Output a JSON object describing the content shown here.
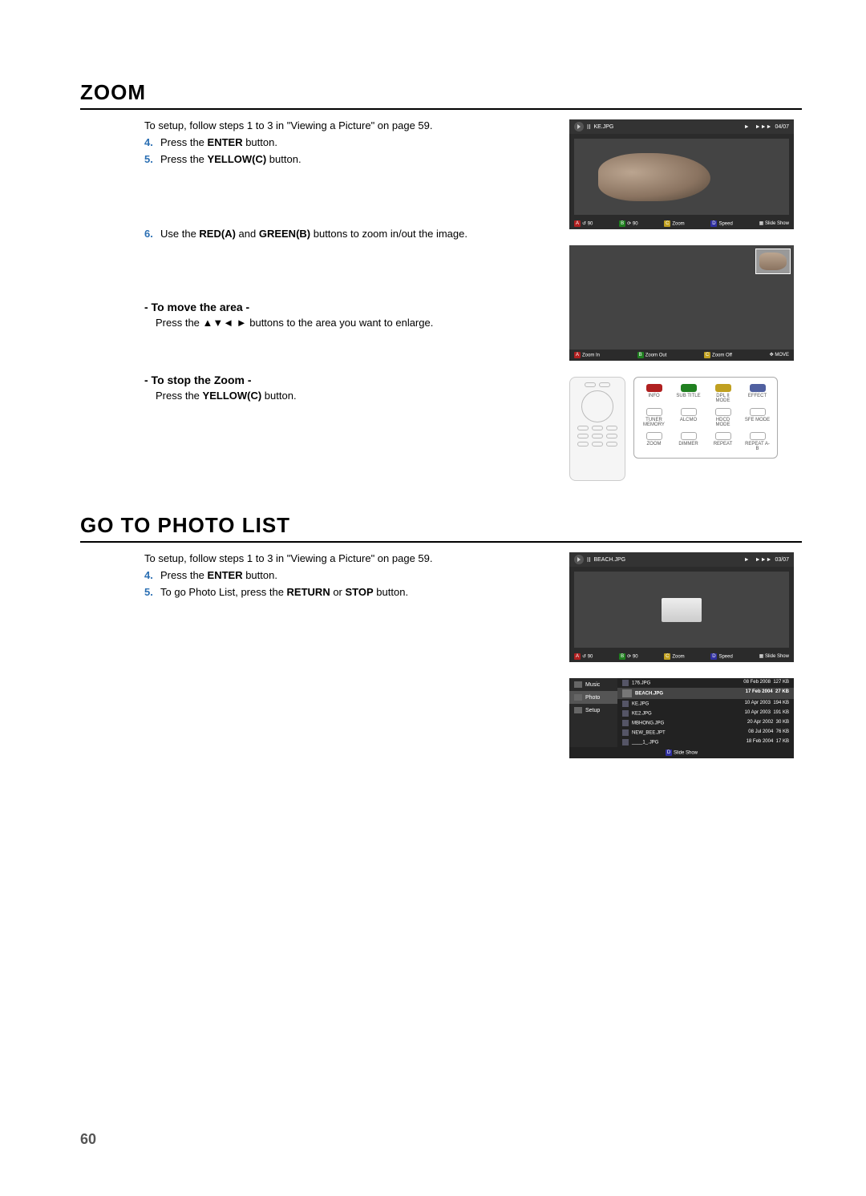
{
  "zoom": {
    "title": "ZOOM",
    "intro": "To setup, follow steps 1 to 3 in \"Viewing a Picture\" on page 59.",
    "steps": {
      "s4_num": "4.",
      "s4": "Press the ENTER button.",
      "s5_num": "5.",
      "s5": "Press the YELLOW(C) button.",
      "s6_num": "6.",
      "s6": "Use the RED(A) and GREEN(B) buttons to zoom in/out the image."
    },
    "move_heading": "- To move the area -",
    "move_body_pre": "Press the ",
    "move_arrows": "▲▼◄ ►",
    "move_body_post": " buttons to the area you want to enlarge.",
    "stop_heading": "- To stop the Zoom -",
    "stop_body": "Press the YELLOW(C) button."
  },
  "osd1": {
    "filename": "KE.JPG",
    "counter": "04/07",
    "bottom": {
      "a_label": "90",
      "b_label": "90",
      "c_label": "Zoom",
      "d_label": "Speed",
      "slide": "Slide Show"
    },
    "play_icon": "►",
    "skip_icon": "►►►"
  },
  "osd2": {
    "bottom": {
      "a_label": "Zoom In",
      "b_label": "Zoom Out",
      "c_label": "Zoom Off",
      "move": "MOVE"
    }
  },
  "remote": {
    "keys": {
      "info": "INFO",
      "subtitle": "SUB TITLE",
      "dpln": "DPL II",
      "mode": "MODE",
      "effect": "EFFECT",
      "tuner_memory": "TUNER MEMORY",
      "alcmo": "ALCMO",
      "hdcd_mode": "HDCD MODE",
      "sfe_mode": "SFE MODE",
      "zoom": "ZOOM",
      "dimmer": "DIMMER",
      "repeat": "REPEAT",
      "repeat_ab": "REPEAT A-B"
    },
    "color_keys": {
      "A": "A",
      "B": "B",
      "C": "C",
      "D": "D"
    }
  },
  "photolist": {
    "title": "GO TO PHOTO LIST",
    "intro": "To setup, follow steps 1 to 3 in \"Viewing a Picture\" on page 59.",
    "steps": {
      "s4_num": "4.",
      "s4": "Press the ENTER button.",
      "s5_num": "5.",
      "s5": "To go Photo List, press the RETURN or STOP button."
    }
  },
  "osd3": {
    "filename": "BEACH.JPG",
    "counter": "03/07"
  },
  "list": {
    "side": {
      "music": "Music",
      "photo": "Photo",
      "setup": "Setup"
    },
    "header": {
      "name": "BEACH.JPG",
      "date": "17 Feb 2004",
      "size": "27 KB"
    },
    "rows": [
      {
        "name": "176.JPG",
        "date": "08 Feb 2008",
        "size": "127 KB"
      },
      {
        "name": "KE.JPG",
        "date": "10 Apr 2003",
        "size": "194 KB"
      },
      {
        "name": "KE2.JPG",
        "date": "10 Apr 2003",
        "size": "191 KB"
      },
      {
        "name": "MBHONG.JPG",
        "date": "20 Apr 2002",
        "size": "30 KB"
      },
      {
        "name": "NEW_BEE.JPT",
        "date": "08 Jul 2004",
        "size": "76 KB"
      },
      {
        "name": "____1_.JPG",
        "date": "18 Feb 2004",
        "size": "17 KB"
      }
    ],
    "bottom": "Slide Show"
  },
  "page_number": "60",
  "keys": {
    "A": "A",
    "B": "B",
    "C": "C",
    "D": "D"
  },
  "icons": {
    "pause": "II",
    "rotate": "⟳",
    "play_symbol": "►",
    "skip_symbol": "►►►",
    "move_cross": "✥"
  }
}
